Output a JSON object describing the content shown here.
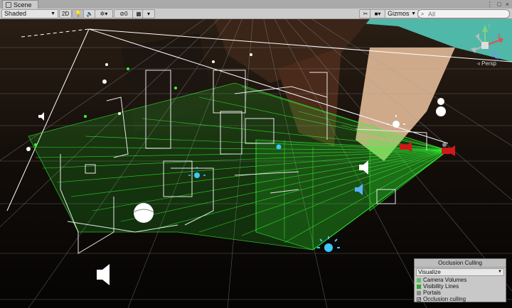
{
  "window": {
    "tab_title": "Scene"
  },
  "toolbar": {
    "draw_mode": "Shaded",
    "mode_2d": "2D",
    "hidden_count": "0",
    "gizmos_label": "Gizmos",
    "search_placeholder": "All"
  },
  "viewport": {
    "projection_label": "Persp",
    "gizmo_axes": [
      "x",
      "y",
      "z"
    ]
  },
  "occlusion_panel": {
    "title": "Occlusion Culling",
    "mode_value": "Visualize",
    "items": [
      {
        "label": "Camera Volumes",
        "color": "#5fbf5f"
      },
      {
        "label": "Visibility Lines",
        "color": "#2fa82f"
      },
      {
        "label": "Portals",
        "color": "#8a8a8a"
      }
    ],
    "occlusion_toggle": {
      "label": "Occlusion culling",
      "checked": true
    }
  },
  "colors": {
    "visibility_green": "#33ff33",
    "wireframe": "#e8e8e8",
    "grid": "#9a9a9a",
    "light_icon": "#3cc8ff",
    "camera_icon": "#d01818"
  }
}
